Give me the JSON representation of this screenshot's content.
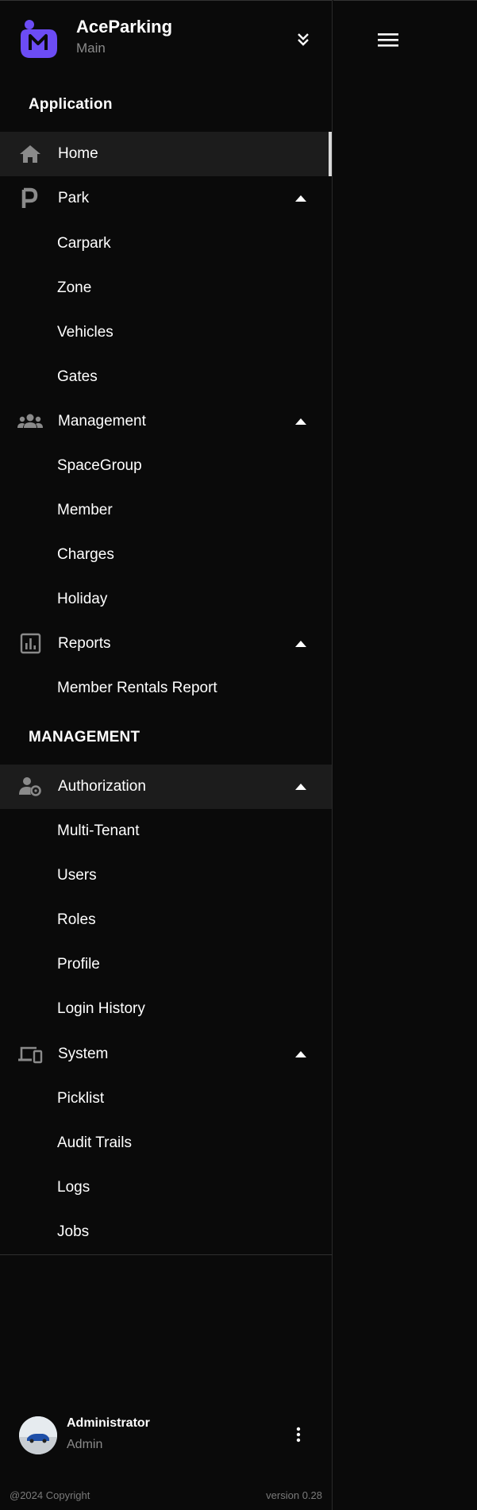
{
  "brand": {
    "name": "AceParking",
    "subtitle": "Main",
    "accent_color": "#6c4cf5",
    "switch_icon": "double-chevron-down-icon"
  },
  "sections": {
    "application": "Application",
    "management": "MANAGEMENT"
  },
  "nav": {
    "home": {
      "label": "Home",
      "icon": "home-icon"
    },
    "park": {
      "label": "Park",
      "icon": "parking-icon",
      "items": [
        "Carpark",
        "Zone",
        "Vehicles",
        "Gates"
      ]
    },
    "management": {
      "label": "Management",
      "icon": "group-icon",
      "items": [
        "SpaceGroup",
        "Member",
        "Charges",
        "Holiday"
      ]
    },
    "reports": {
      "label": "Reports",
      "icon": "bar-chart-icon",
      "items": [
        "Member Rentals Report"
      ]
    },
    "authorization": {
      "label": "Authorization",
      "icon": "user-settings-icon",
      "items": [
        "Multi-Tenant",
        "Users",
        "Roles",
        "Profile",
        "Login History"
      ]
    },
    "system": {
      "label": "System",
      "icon": "devices-icon",
      "items": [
        "Picklist",
        "Audit Trails",
        "Logs",
        "Jobs"
      ]
    }
  },
  "user": {
    "name": "Administrator",
    "role": "Admin"
  },
  "footer": {
    "copyright": "@2024 Copyright",
    "version": "version 0.28"
  },
  "colors": {
    "background": "#0a0a0a",
    "active_row": "#1c1c1c",
    "muted_text": "#8a8a8a"
  }
}
